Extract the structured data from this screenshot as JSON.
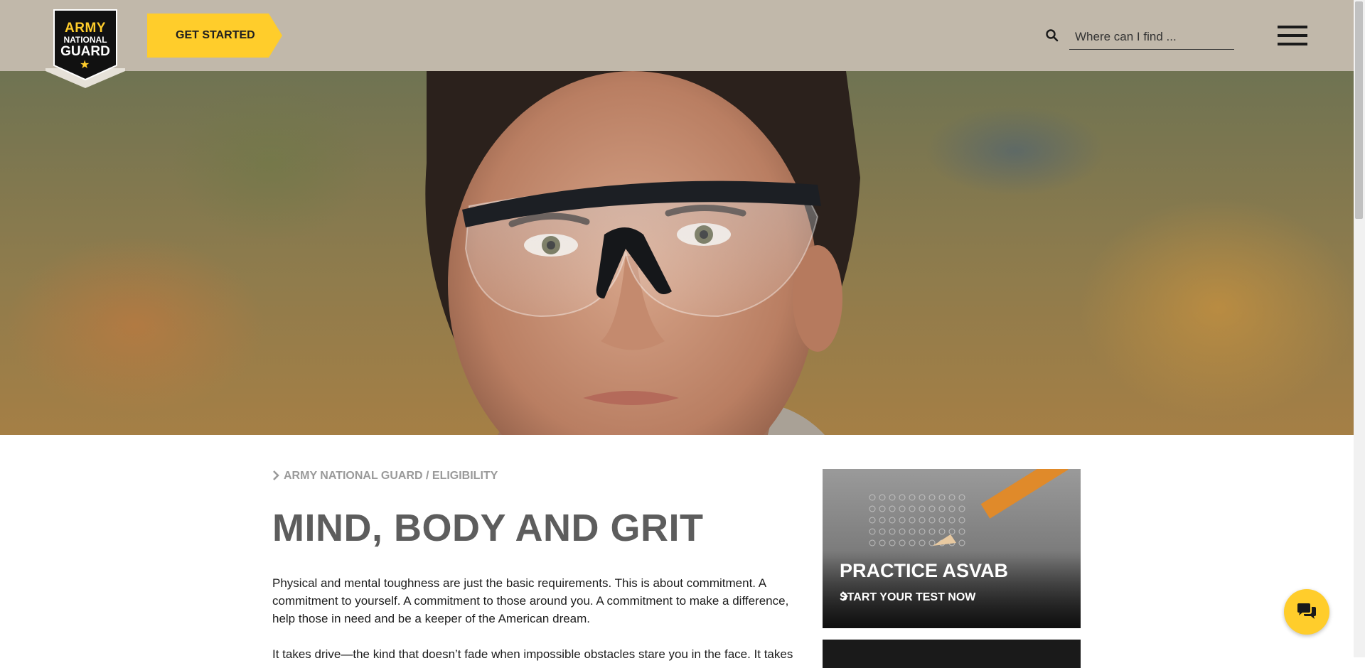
{
  "header": {
    "logo": {
      "line1": "ARMY",
      "line2": "NATIONAL",
      "line3": "GUARD"
    },
    "get_started_label": "GET STARTED",
    "search": {
      "placeholder": "Where can I find ..."
    }
  },
  "main": {
    "breadcrumb": "ARMY NATIONAL GUARD / ELIGIBILITY",
    "title": "MIND, BODY AND GRIT",
    "intro": "Physical and mental toughness are just the basic requirements. This is about commitment. A commitment to yourself. A commitment to those around you. A commitment to make a difference, help those in need and be a keeper of the American dream.",
    "paragraph2": "It takes drive—the kind that doesn’t fade when impossible obstacles stare you in the face. It takes"
  },
  "sidebar": {
    "card": {
      "title": "PRACTICE ASVAB",
      "cta": "START YOUR TEST NOW"
    }
  },
  "colors": {
    "header_bg": "#c1b8aa",
    "accent_yellow": "#ffcd2b",
    "title_gray": "#5d5d5d",
    "breadcrumb_gray": "#9a9a9a"
  },
  "icons": {
    "search": "search-icon",
    "menu": "hamburger-menu-icon",
    "chat": "chat-bubbles-icon",
    "breadcrumb": "chevron-right-icon",
    "cta": "chevron-right-icon",
    "logo_star": "star-icon"
  }
}
